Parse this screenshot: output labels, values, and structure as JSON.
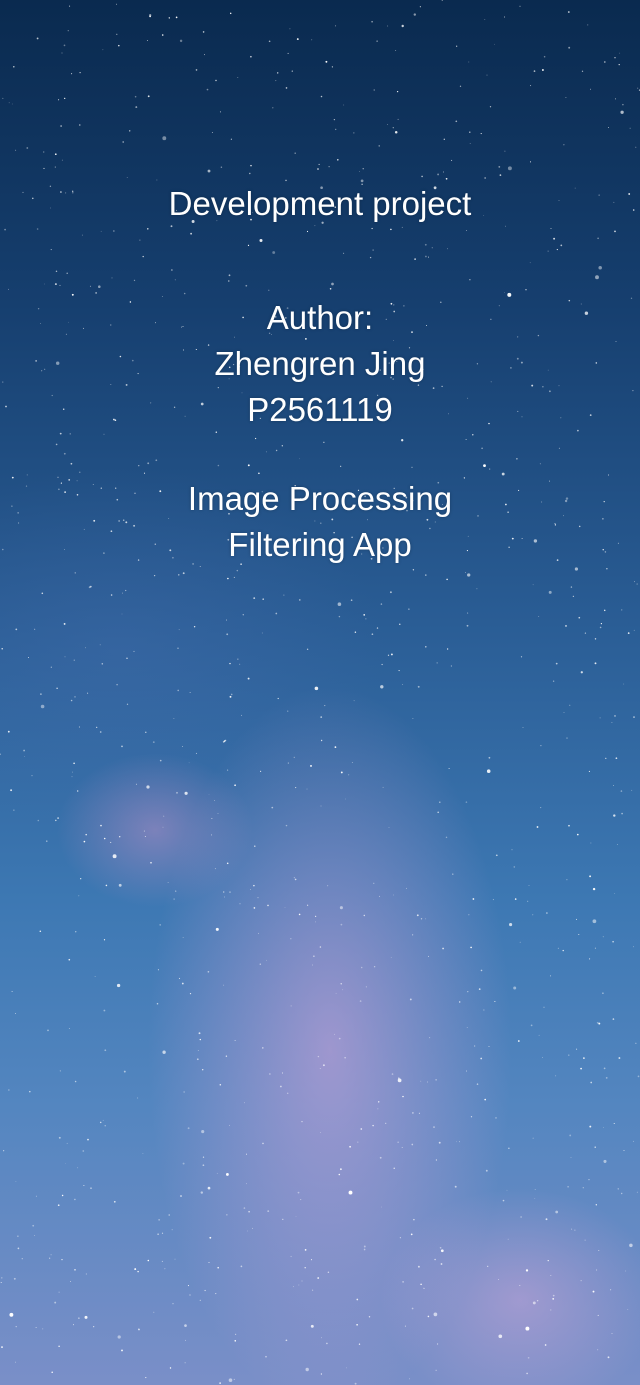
{
  "screen": {
    "project_label": "Development project",
    "author_label": "Author:",
    "author_name": "Zhengren Jing",
    "author_id": "P2561119",
    "app_title_line1": "Image Processing",
    "app_title_line2": "Filtering App"
  },
  "background": {
    "description_icon": "milky-way-night-sky",
    "colors": {
      "top": "#0a2a4f",
      "middle": "#3d78b3",
      "bottom": "#7a8fc8",
      "nebula": "#e0a8de"
    }
  }
}
